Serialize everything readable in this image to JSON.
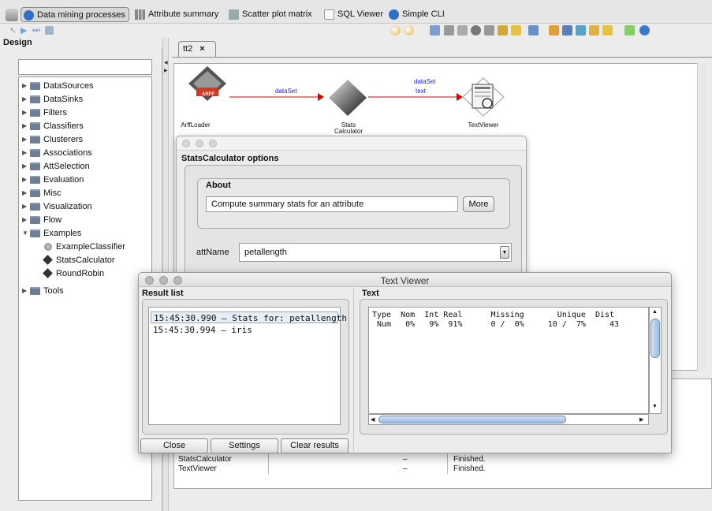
{
  "top_tabs": [
    {
      "label": "Data mining processes",
      "icon": "knowledgeflow-icon",
      "active": true
    },
    {
      "label": "Attribute summary",
      "icon": "bar-chart-icon"
    },
    {
      "label": "Scatter plot matrix",
      "icon": "matrix-icon"
    },
    {
      "label": "SQL Viewer",
      "icon": "database-icon"
    },
    {
      "label": "Simple CLI",
      "icon": "cli-icon"
    }
  ],
  "design": {
    "title": "Design",
    "search_value": "",
    "tree": [
      {
        "label": "DataSources"
      },
      {
        "label": "DataSinks"
      },
      {
        "label": "Filters"
      },
      {
        "label": "Classifiers"
      },
      {
        "label": "Clusterers"
      },
      {
        "label": "Associations"
      },
      {
        "label": "AttSelection"
      },
      {
        "label": "Evaluation"
      },
      {
        "label": "Misc"
      },
      {
        "label": "Visualization"
      },
      {
        "label": "Flow"
      },
      {
        "label": "Examples"
      },
      {
        "label": "ExampleClassifier"
      },
      {
        "label": "StatsCalculator"
      },
      {
        "label": "RoundRobin"
      },
      {
        "label": "Tools"
      }
    ]
  },
  "flow": {
    "tab_label": "tt2",
    "tab_close": "×",
    "nodes": {
      "arff_label": "ArffLoader",
      "arff_badge": "ARFF",
      "stats_label_line1": "Stats",
      "stats_label_line2": "Calculator",
      "viewer_label": "TextViewer"
    },
    "connections": {
      "first": "dataSet",
      "second_line1": "dataSet",
      "second_line2": "text"
    },
    "colors": {
      "connection": "#e00000",
      "label": "#1a1aff"
    }
  },
  "status_rows": [
    {
      "component": "StatsCalculator",
      "dash": "–",
      "status": "Finished."
    },
    {
      "component": "TextViewer",
      "dash": "–",
      "status": "Finished."
    }
  ],
  "stats_dialog": {
    "heading": "StatsCalculator options",
    "about_label": "About",
    "about_text": "Compute summary stats for an attribute",
    "more_label": "More",
    "attname_label": "attName",
    "attname_value": "petallength"
  },
  "text_viewer": {
    "title": "Text Viewer",
    "result_list_label": "Result list",
    "results": [
      {
        "label": "15:45:30.990 – Stats for: petallength",
        "selected": true
      },
      {
        "label": "15:45:30.994 – iris",
        "selected": false
      }
    ],
    "text_label": "Text",
    "text_content": "Type  Nom  Int Real      Missing       Unique  Dist\n Num   0%   9%  91%      0 /  0%     10 /  7%     43",
    "buttons": {
      "close": "Close",
      "settings": "Settings",
      "clear": "Clear results"
    }
  }
}
